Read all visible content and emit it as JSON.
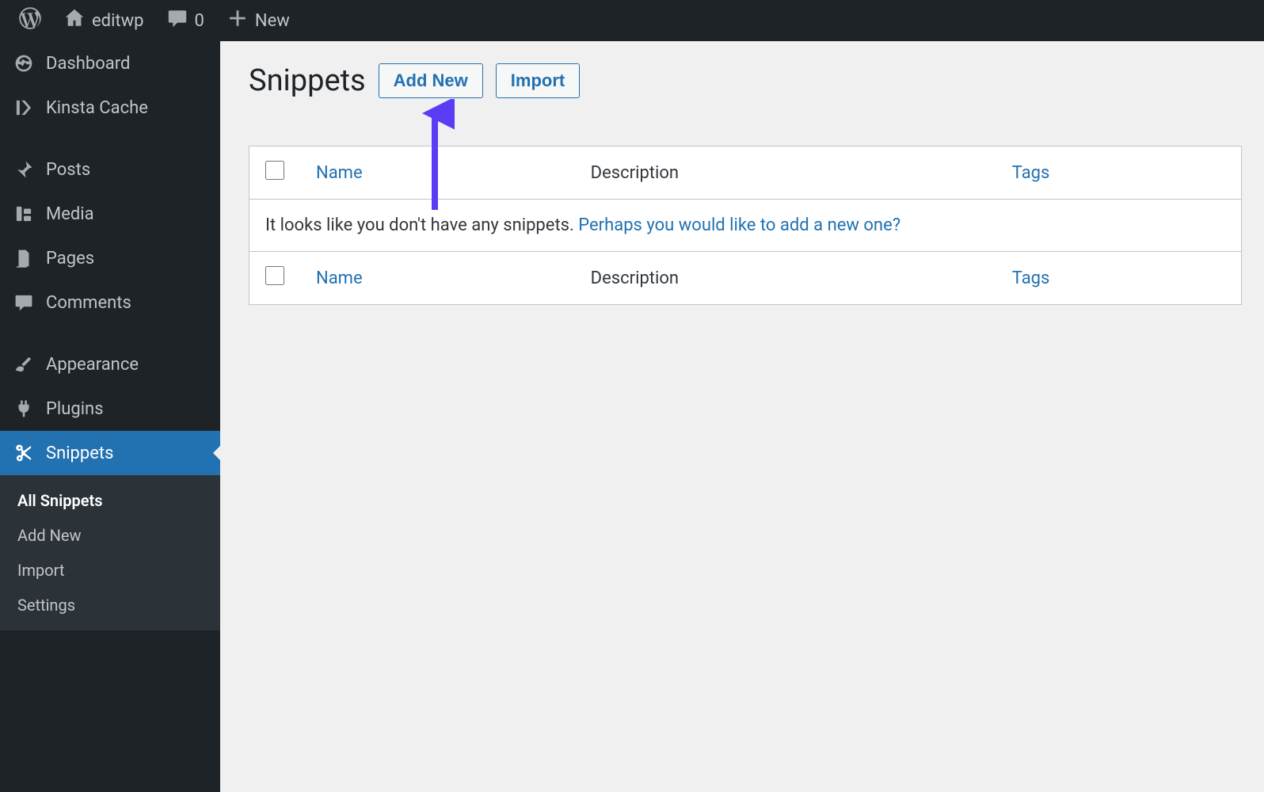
{
  "adminbar": {
    "site_name": "editwp",
    "comments_count": "0",
    "new_label": "New"
  },
  "sidebar": {
    "items": [
      {
        "id": "dashboard",
        "label": "Dashboard"
      },
      {
        "id": "kinsta-cache",
        "label": "Kinsta Cache"
      },
      {
        "sep": true
      },
      {
        "id": "posts",
        "label": "Posts"
      },
      {
        "id": "media",
        "label": "Media"
      },
      {
        "id": "pages",
        "label": "Pages"
      },
      {
        "id": "comments",
        "label": "Comments"
      },
      {
        "sep": true
      },
      {
        "id": "appearance",
        "label": "Appearance"
      },
      {
        "id": "plugins",
        "label": "Plugins"
      },
      {
        "id": "snippets",
        "label": "Snippets",
        "current": true
      }
    ],
    "submenu": [
      {
        "label": "All Snippets",
        "active": true
      },
      {
        "label": "Add New"
      },
      {
        "label": "Import"
      },
      {
        "label": "Settings"
      }
    ]
  },
  "page": {
    "title": "Snippets",
    "add_new_label": "Add New",
    "import_label": "Import"
  },
  "table": {
    "col_name": "Name",
    "col_description": "Description",
    "col_tags": "Tags",
    "empty_text": "It looks like you don't have any snippets. ",
    "empty_link": "Perhaps you would like to add a new one?"
  },
  "annotation": {
    "arrow_color": "#5a3cf4"
  }
}
